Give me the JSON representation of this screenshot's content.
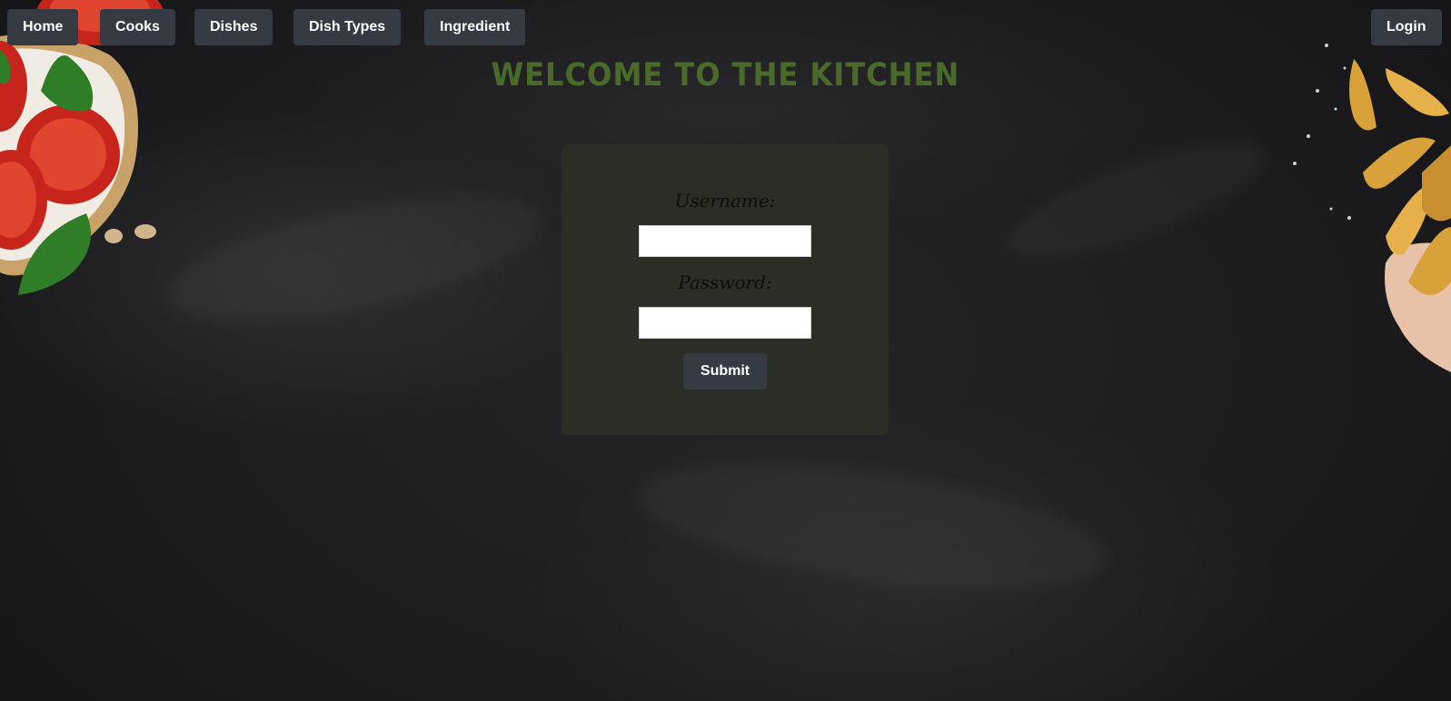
{
  "nav": {
    "home": "Home",
    "cooks": "Cooks",
    "dishes": "Dishes",
    "dish_types": "Dish Types",
    "ingredient": "Ingredient",
    "login": "Login"
  },
  "page": {
    "title": "Welcome to the Kitchen"
  },
  "login_form": {
    "username_label": "Username:",
    "username_value": "",
    "password_label": "Password:",
    "password_value": "",
    "submit_label": "Submit"
  },
  "colors": {
    "background": "#1e1e20",
    "nav_button": "#363a42",
    "title": "#4a6a2a",
    "card": "#2b2e24"
  },
  "decorations": {
    "top_left": "bruschetta-tomato-basil-image",
    "top_right": "potato-wedges-image"
  }
}
